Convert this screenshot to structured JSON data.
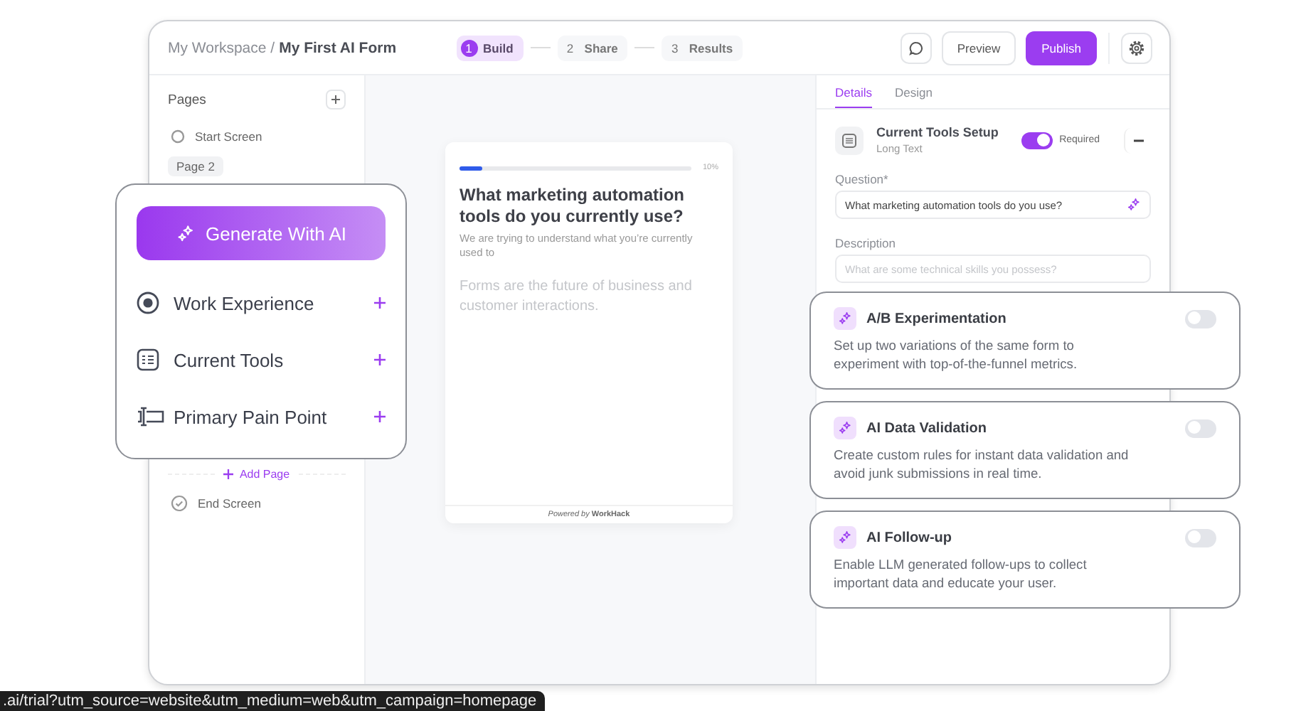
{
  "header": {
    "breadcrumb_root": "My Workspace /",
    "form_name": "My First AI Form",
    "steps": [
      {
        "number": "1",
        "label": "Build",
        "selected": true
      },
      {
        "number": "2",
        "label": "Share",
        "selected": false
      },
      {
        "number": "3",
        "label": "Results",
        "selected": false
      }
    ],
    "preview_button": "Preview",
    "publish_button": "Publish"
  },
  "sidebar": {
    "title": "Pages",
    "pages": [
      {
        "kind": "start",
        "label": "Start Screen",
        "selected": false
      },
      {
        "kind": "page",
        "label": "Page 2",
        "selected": true
      },
      {
        "kind": "end",
        "label": "End Screen",
        "selected": false
      }
    ],
    "add_page": "Add Page"
  },
  "preview": {
    "progress": {
      "level": 0.1,
      "reading": "10%"
    },
    "question": "What marketing automation tools do you currently use?",
    "description": "We are trying to understand what you’re currently used to",
    "answer_placeholder": "Forms are the future of business and customer interactions.",
    "footer": "*Powered by* **WorkHack**"
  },
  "panel": {
    "tabs": [
      {
        "label": "Details",
        "selected": true
      },
      {
        "label": "Design",
        "selected": false
      }
    ],
    "field": {
      "title": "Current Tools Setup",
      "type": "Long Text",
      "required": {
        "label": "Required",
        "on": true
      }
    },
    "question_label": "Question*",
    "question_value": "What marketing automation tools do you use?",
    "description_label": "Description",
    "description_placeholder": "What are some technical skills you possess?"
  },
  "ai_popup": {
    "generate_button": "Generate With AI",
    "items": [
      {
        "kind": "radio",
        "label": "Work Experience"
      },
      {
        "kind": "list",
        "label": "Current Tools"
      },
      {
        "kind": "text-input",
        "label": "Primary Pain Point"
      }
    ]
  },
  "features": [
    {
      "title": "A/B Experimentation",
      "description": "Set up two variations of the same form to experiment with top-of-the-funnel metrics.",
      "on": false
    },
    {
      "title": "AI Data Validation",
      "description": "Create custom rules for instant data validation and avoid junk submissions in real time.",
      "on": false
    },
    {
      "title": "AI Follow-up",
      "description": "Enable LLM generated follow-ups to collect important data and educate your user.",
      "on": false
    }
  ],
  "status_url": ".ai/trial?utm_source=website&utm_medium=web&utm_campaign=homepage"
}
